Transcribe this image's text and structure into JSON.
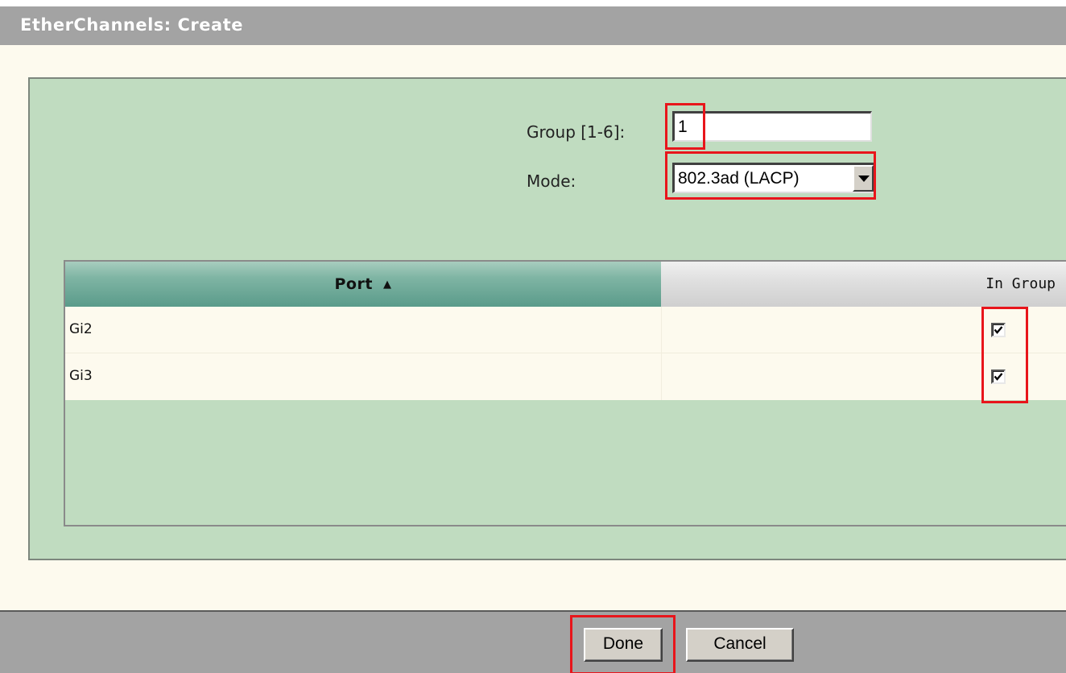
{
  "window": {
    "title": "EtherChannels: Create"
  },
  "form": {
    "group_label": "Group [1-6]:",
    "group_value": "1",
    "mode_label": "Mode:",
    "mode_value": "802.3ad (LACP)"
  },
  "table": {
    "columns": [
      {
        "label": "Port",
        "sort": "ascending"
      },
      {
        "label": "In Group"
      }
    ],
    "rows": [
      {
        "port": "Gi2",
        "in_group": true
      },
      {
        "port": "Gi3",
        "in_group": true
      }
    ]
  },
  "footer": {
    "done_label": "Done",
    "cancel_label": "Cancel"
  },
  "colors": {
    "highlight": "#e8151b",
    "panel": "#c0dcc0",
    "titlebar": "#a3a3a3"
  }
}
